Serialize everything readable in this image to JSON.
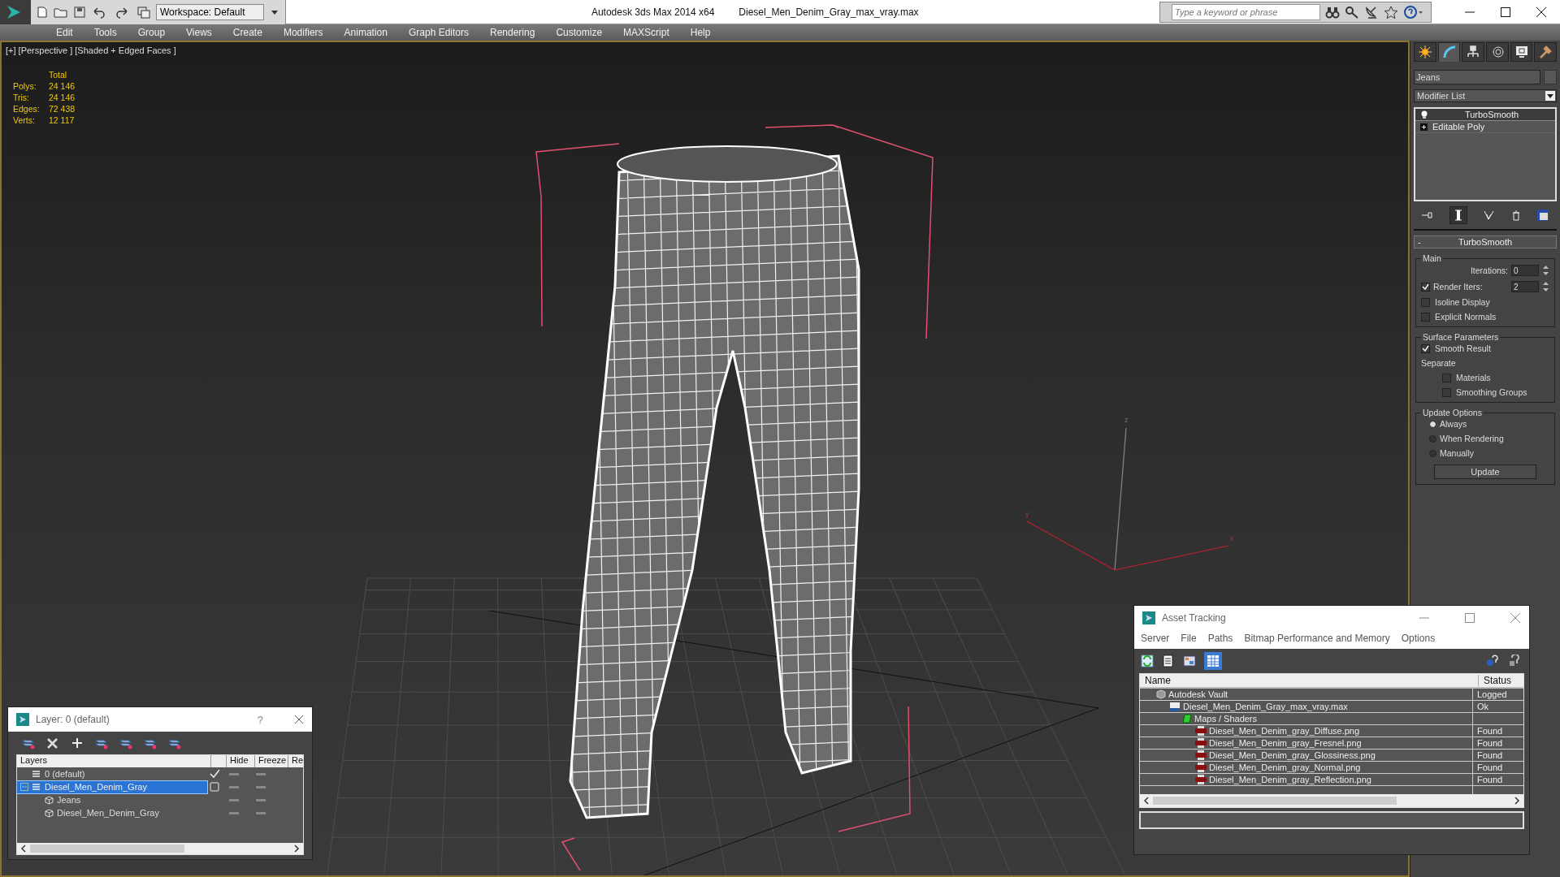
{
  "title_bar": {
    "workspace": "Workspace: Default",
    "app_title": "Autodesk 3ds Max  2014 x64",
    "file_name": "Diesel_Men_Denim_Gray_max_vray.max",
    "search": {
      "placeholder": "Type a keyword or phrase"
    }
  },
  "menu": [
    "Edit",
    "Tools",
    "Group",
    "Views",
    "Create",
    "Modifiers",
    "Animation",
    "Graph Editors",
    "Rendering",
    "Customize",
    "MAXScript",
    "Help"
  ],
  "viewport": {
    "label": "[+] [Perspective ] [Shaded + Edged Faces ]",
    "stats_header": "Total",
    "stats": [
      {
        "label": "Polys:",
        "value": "24 146"
      },
      {
        "label": "Tris:",
        "value": "24 146"
      },
      {
        "label": "Edges:",
        "value": "72 438"
      },
      {
        "label": "Verts:",
        "value": "12 117"
      }
    ],
    "axis_labels": [
      "z",
      "y",
      "x"
    ]
  },
  "command_panel": {
    "tabs": [
      {
        "kind": "create",
        "selected": false
      },
      {
        "kind": "modify",
        "selected": true
      },
      {
        "kind": "hierarchy",
        "selected": false
      },
      {
        "kind": "motion",
        "selected": false
      },
      {
        "kind": "display",
        "selected": false
      },
      {
        "kind": "utilities",
        "selected": false
      }
    ],
    "object_name": "Jeans",
    "modifier_list": "Modifier List",
    "stack": [
      {
        "label": "TurboSmooth",
        "kind": "bulb",
        "selected": true
      },
      {
        "label": "Editable Poly",
        "kind": "plus",
        "selected": false
      }
    ],
    "rollout": {
      "toggle": "-",
      "title": "TurboSmooth",
      "main": {
        "title": "Main",
        "iterations": {
          "label": "Iterations:",
          "value": "0"
        },
        "render_iters": {
          "label": "Render Iters:",
          "value": "2",
          "checked": true
        },
        "options": [
          {
            "label": "Isoline Display",
            "checked": false
          },
          {
            "label": "Explicit Normals",
            "checked": false
          }
        ]
      },
      "surface": {
        "title": "Surface Parameters",
        "smooth_result": {
          "label": "Smooth Result",
          "checked": true
        },
        "separate": "Separate",
        "options": [
          {
            "label": "Materials",
            "checked": false
          },
          {
            "label": "Smoothing Groups",
            "checked": false
          }
        ]
      },
      "update": {
        "title": "Update Options",
        "options": [
          {
            "label": "Always",
            "selected": true
          },
          {
            "label": "When Rendering",
            "selected": false
          },
          {
            "label": "Manually",
            "selected": false
          }
        ],
        "button": "Update"
      }
    }
  },
  "layer_dialog": {
    "title": "Layer: 0 (default)",
    "help": "?",
    "columns": [
      "Layers",
      "Hide",
      "Freeze",
      "Re"
    ],
    "rows": [
      {
        "name": "0 (default)",
        "kind": "layer",
        "current": true,
        "selected": false
      },
      {
        "name": "Diesel_Men_Denim_Gray",
        "kind": "layer",
        "current": false,
        "selected": true,
        "expanded": true,
        "children": [
          {
            "name": "Jeans",
            "kind": "object",
            "selected": false
          },
          {
            "name": "Diesel_Men_Denim_Gray",
            "kind": "object",
            "selected": false
          }
        ]
      }
    ]
  },
  "asset_tracking": {
    "title": "Asset Tracking",
    "menu": [
      "Server",
      "File",
      "Paths",
      "Bitmap Performance and Memory",
      "Options"
    ],
    "columns": [
      "Name",
      "Status"
    ],
    "tree": [
      {
        "name": "Autodesk Vault",
        "status": "Logged",
        "kind": "vault",
        "children": [
          {
            "name": "Diesel_Men_Denim_Gray_max_vray.max",
            "status": "Ok",
            "kind": "max",
            "children": [
              {
                "name": "Maps / Shaders",
                "kind": "maps",
                "children": [
                  {
                    "name": "Diesel_Men_Denim_gray_Diffuse.png",
                    "status": "Found",
                    "kind": "png"
                  },
                  {
                    "name": "Diesel_Men_Denim_gray_Fresnel.png",
                    "status": "Found",
                    "kind": "png"
                  },
                  {
                    "name": "Diesel_Men_Denim_gray_Glossiness.png",
                    "status": "Found",
                    "kind": "png"
                  },
                  {
                    "name": "Diesel_Men_Denim_gray_Normal.png",
                    "status": "Found",
                    "kind": "png"
                  },
                  {
                    "name": "Diesel_Men_Denim_gray_Reflection.png",
                    "status": "Found",
                    "kind": "png"
                  }
                ]
              }
            ]
          }
        ]
      }
    ]
  }
}
